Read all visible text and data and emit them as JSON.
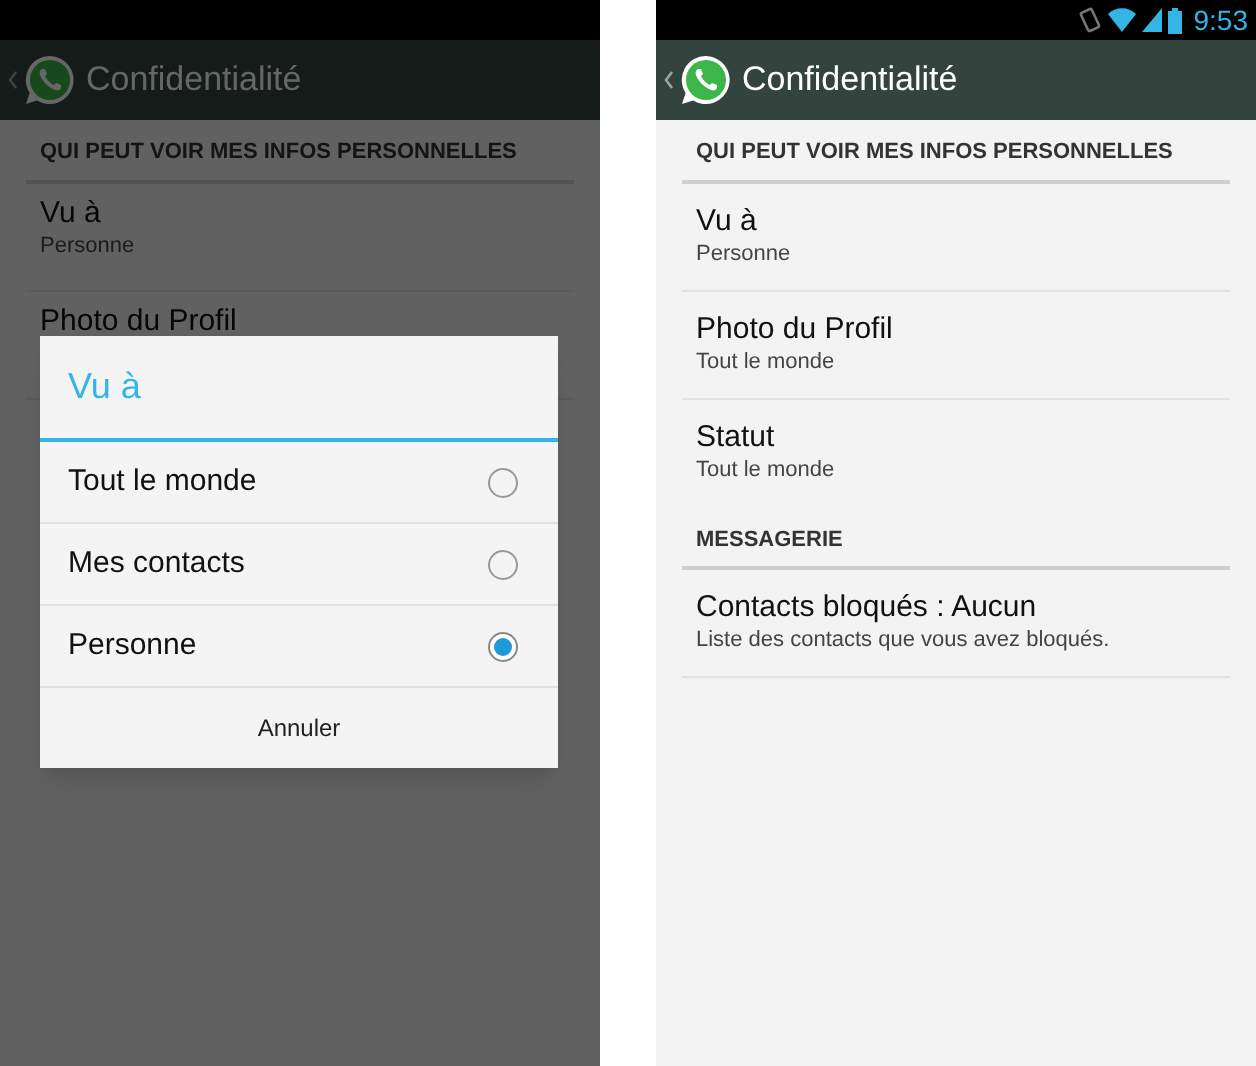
{
  "left_screen": {
    "action_bar": {
      "title": "Confidentialité"
    },
    "section_header": "QUI PEUT VOIR MES INFOS PERSONNELLES",
    "items": [
      {
        "title": "Vu à",
        "subtitle": "Personne"
      },
      {
        "title": "Photo du Profil"
      }
    ],
    "dialog": {
      "title": "Vu à",
      "options": [
        {
          "label": "Tout le monde",
          "selected": false
        },
        {
          "label": "Mes contacts",
          "selected": false
        },
        {
          "label": "Personne",
          "selected": true
        }
      ],
      "cancel": "Annuler"
    }
  },
  "right_screen": {
    "status_bar": {
      "time": "9:53"
    },
    "action_bar": {
      "title": "Confidentialité"
    },
    "sections": [
      {
        "header": "QUI PEUT VOIR MES INFOS PERSONNELLES",
        "items": [
          {
            "title": "Vu à",
            "subtitle": "Personne"
          },
          {
            "title": "Photo du Profil",
            "subtitle": "Tout le monde"
          },
          {
            "title": "Statut",
            "subtitle": "Tout le monde"
          }
        ]
      },
      {
        "header": "MESSAGERIE",
        "items": [
          {
            "title": "Contacts bloqués : Aucun",
            "subtitle": "Liste des contacts que vous avez bloqués."
          }
        ]
      }
    ]
  }
}
